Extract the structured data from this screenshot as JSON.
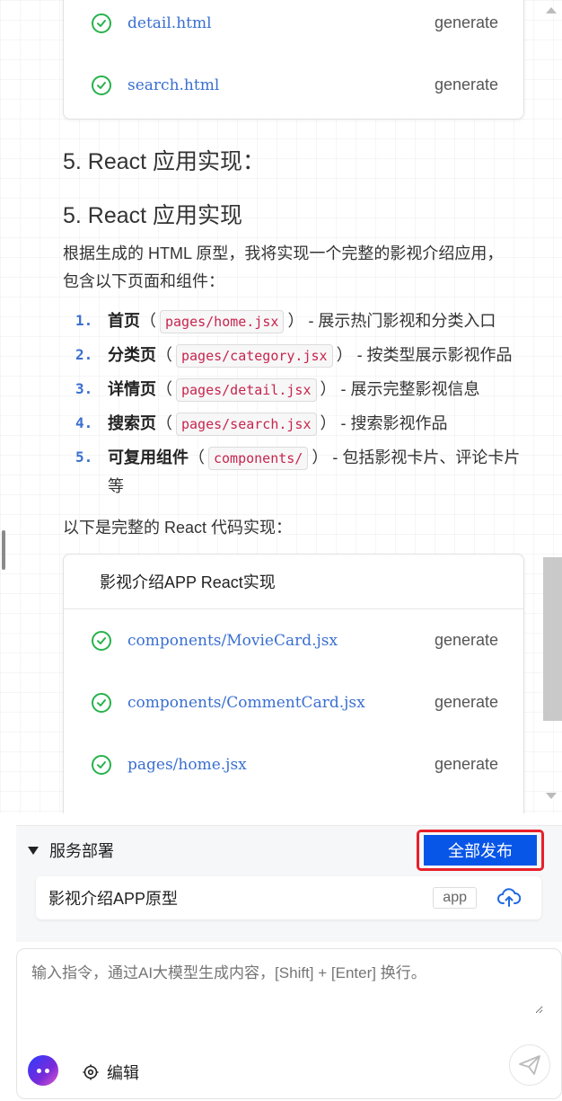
{
  "top_card": {
    "files": [
      {
        "name": "detail.html",
        "action": "generate"
      },
      {
        "name": "search.html",
        "action": "generate"
      }
    ]
  },
  "section_heading_1": "5. React 应用实现：",
  "section_heading_2": "5. React 应用实现",
  "intro": "根据生成的 HTML 原型，我将实现一个完整的影视介绍应用，包含以下页面和组件：",
  "steps": [
    {
      "num": "1.",
      "title": "首页",
      "code": "pages/home.jsx",
      "desc": " - 展示热门影视和分类入口"
    },
    {
      "num": "2.",
      "title": "分类页",
      "code": "pages/category.jsx",
      "desc": " - 按类型展示影视作品"
    },
    {
      "num": "3.",
      "title": "详情页",
      "code": "pages/detail.jsx",
      "desc": " - 展示完整影视信息"
    },
    {
      "num": "4.",
      "title": "搜索页",
      "code": "pages/search.jsx",
      "desc": " - 搜索影视作品"
    },
    {
      "num": "5.",
      "title": "可复用组件",
      "code": "components/",
      "desc": " - 包括影视卡片、评论卡片等"
    }
  ],
  "outro": "以下是完整的 React 代码实现：",
  "bottom_card": {
    "title": "影视介绍APP React实现",
    "files": [
      {
        "name": "components/MovieCard.jsx",
        "action": "generate"
      },
      {
        "name": "components/CommentCard.jsx",
        "action": "generate"
      },
      {
        "name": "pages/home.jsx",
        "action": "generate"
      }
    ]
  },
  "deploy": {
    "title": "服务部署",
    "publish_all": "全部发布",
    "app": {
      "name": "影视介绍APP原型",
      "tag": "app",
      "icon": "cloud-upload-icon"
    }
  },
  "input": {
    "placeholder": "输入指令，通过AI大模型生成内容，[Shift] + [Enter] 换行。",
    "edit_label": "编辑"
  },
  "colors": {
    "accent": "#0856e8",
    "highlight_border": "#e81f2a",
    "success": "#27b24c",
    "link": "#3a6fd0"
  }
}
